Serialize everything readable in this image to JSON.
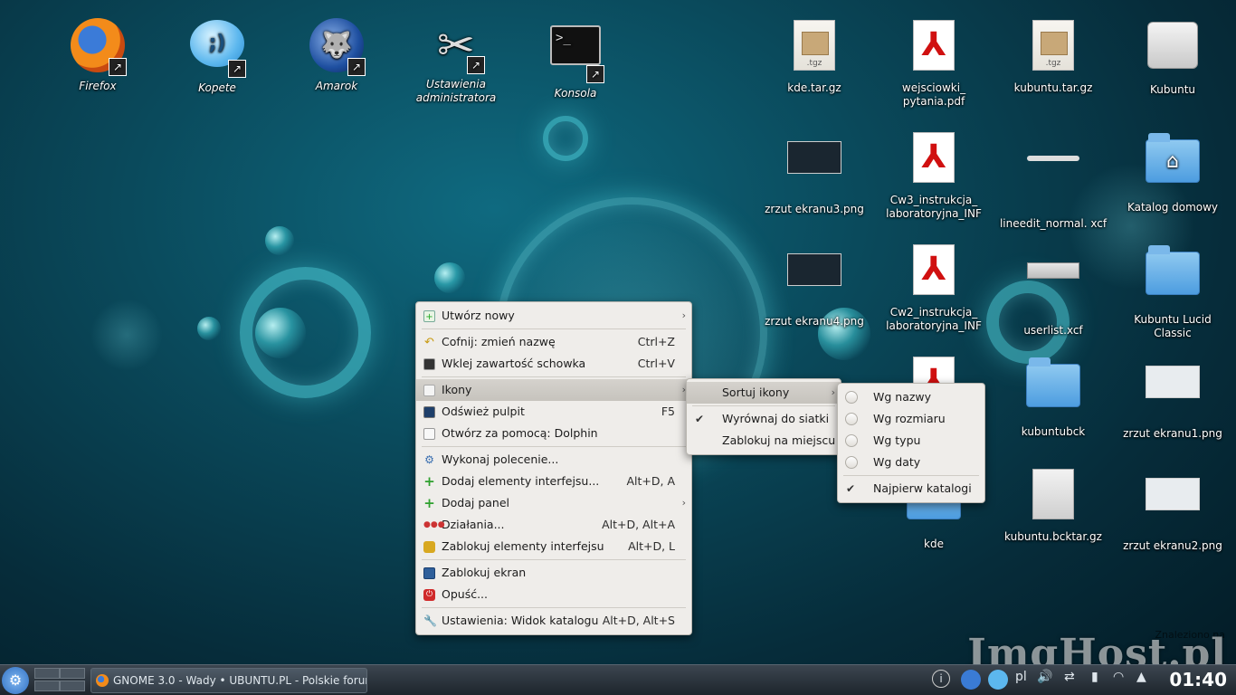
{
  "desktop": {
    "icons": [
      {
        "label": "Firefox",
        "icon": "firefox-icon"
      },
      {
        "label": "Kopete",
        "icon": "kopete-icon"
      },
      {
        "label": "Amarok",
        "icon": "amarok-icon"
      },
      {
        "label": "Ustawienia administratora",
        "icon": "admin-settings-icon"
      },
      {
        "label": "Konsola",
        "icon": "terminal-icon"
      },
      {
        "label": "kde.tar.gz",
        "icon": "archive-icon"
      },
      {
        "label": "wejsciowki_ pytania.pdf",
        "icon": "pdf-icon"
      },
      {
        "label": "kubuntu.tar.gz",
        "icon": "archive-icon"
      },
      {
        "label": "Kubuntu",
        "icon": "hard-drive-icon"
      },
      {
        "label": "zrzut ekranu3.png",
        "icon": "image-icon"
      },
      {
        "label": "Cw3_instrukcja_ laboratoryjna_INF",
        "icon": "pdf-icon"
      },
      {
        "label": "lineedit_normal. xcf",
        "icon": "xcf-icon"
      },
      {
        "label": "Katalog domowy",
        "icon": "home-folder-icon"
      },
      {
        "label": "zrzut ekranu4.png",
        "icon": "image-icon"
      },
      {
        "label": "Cw2_instrukcja_ laboratoryjna_INF",
        "icon": "pdf-icon"
      },
      {
        "label": "userlist.xcf",
        "icon": "xcf-icon"
      },
      {
        "label": "Kubuntu Lucid Classic",
        "icon": "folder-icon"
      },
      {
        "label": "kubuntubck",
        "icon": "folder-icon"
      },
      {
        "label": "zrzut ekranu1.png",
        "icon": "image-icon"
      },
      {
        "label": "kde",
        "icon": "folder-icon"
      },
      {
        "label": "kubuntu.bcktar.gz",
        "icon": "zip-icon"
      },
      {
        "label": "zrzut ekranu2.png",
        "icon": "image-icon"
      }
    ],
    "tgz_badge": ".tgz",
    "link_glyph": "↗"
  },
  "context_menu": {
    "items": [
      {
        "label": "Utwórz nowy",
        "shortcut": "",
        "submenu": true
      },
      {
        "label": "Cofnij: zmień nazwę",
        "shortcut": "Ctrl+Z"
      },
      {
        "label": "Wklej zawartość schowka",
        "shortcut": "Ctrl+V"
      },
      {
        "label": "Ikony",
        "shortcut": "",
        "submenu": true
      },
      {
        "label": "Odśwież pulpit",
        "shortcut": "F5"
      },
      {
        "label": "Otwórz za pomocą: Dolphin",
        "shortcut": ""
      },
      {
        "label": "Wykonaj polecenie...",
        "shortcut": ""
      },
      {
        "label": "Dodaj elementy interfejsu...",
        "shortcut": "Alt+D, A"
      },
      {
        "label": "Dodaj panel",
        "shortcut": "",
        "submenu": true
      },
      {
        "label": "Działania...",
        "shortcut": "Alt+D, Alt+A"
      },
      {
        "label": "Zablokuj elementy interfejsu",
        "shortcut": "Alt+D, L"
      },
      {
        "label": "Zablokuj ekran",
        "shortcut": ""
      },
      {
        "label": "Opuść...",
        "shortcut": ""
      },
      {
        "label": "Ustawienia: Widok katalogu",
        "shortcut": "Alt+D, Alt+S"
      }
    ]
  },
  "icons_submenu": {
    "items": [
      {
        "label": "Sortuj ikony",
        "submenu": true
      },
      {
        "label": "Wyrównaj do siatki",
        "checked": true
      },
      {
        "label": "Zablokuj na miejscu",
        "checked": false
      }
    ]
  },
  "sort_submenu": {
    "items": [
      {
        "label": "Wg nazwy"
      },
      {
        "label": "Wg rozmiaru"
      },
      {
        "label": "Wg typu"
      },
      {
        "label": "Wg daty"
      },
      {
        "label": "Najpierw katalogi",
        "checked": true
      }
    ]
  },
  "taskbar": {
    "task_title": "GNOME 3.0 - Wady • UBUNTU.PL - Polskie forum",
    "keyboard_layout": "pl",
    "clock": "01:40",
    "tray_info": "i"
  },
  "watermark": {
    "text": "ImgHost.pl",
    "small": "Znaleziono na"
  },
  "colors": {
    "menu_bg": "#efedea",
    "highlight": "#c6c3bd",
    "taskbar": "#1d252c"
  }
}
